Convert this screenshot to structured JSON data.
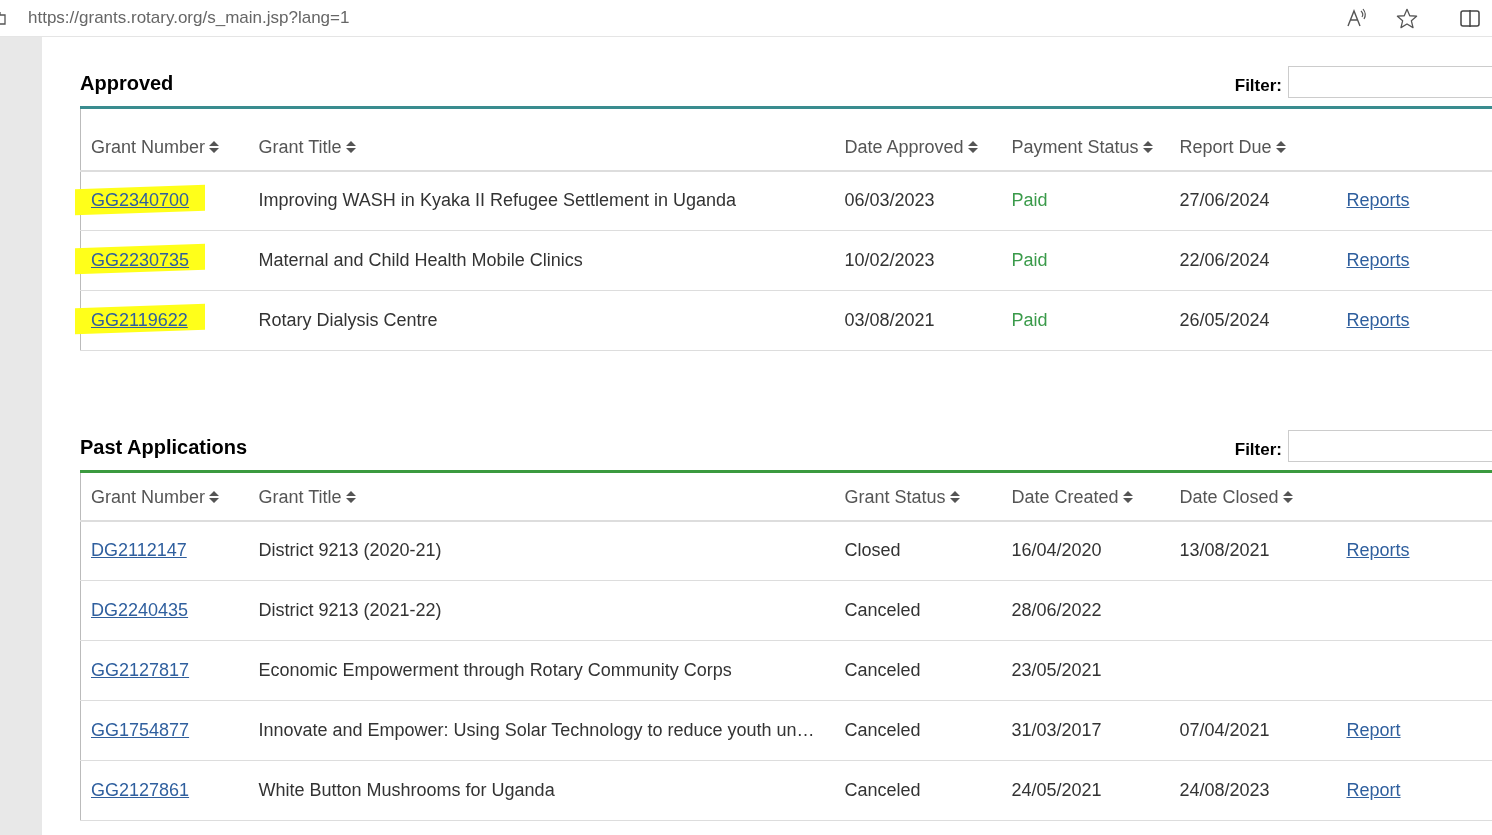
{
  "browser": {
    "url": "https://grants.rotary.org/s_main.jsp?lang=1"
  },
  "sections": [
    {
      "title": "Approved",
      "filter_label": "Filter:",
      "color": "#3a8c8f",
      "columns": [
        {
          "label": "Grant Number",
          "sortable": true
        },
        {
          "label": "Grant Title",
          "sortable": true
        },
        {
          "label": "Date Approved",
          "sortable": true
        },
        {
          "label": "Payment Status",
          "sortable": true
        },
        {
          "label": "Report Due",
          "sortable": true
        }
      ],
      "rows": [
        {
          "grant_number": "GG2340700",
          "highlighted": true,
          "title": "Improving WASH in Kyaka II Refugee Settlement in Uganda",
          "col3": "06/03/2023",
          "col4": "Paid",
          "paid": true,
          "col5": "27/06/2024",
          "link": "Reports"
        },
        {
          "grant_number": "GG2230735",
          "highlighted": true,
          "title": "Maternal and Child Health Mobile Clinics",
          "col3": "10/02/2023",
          "col4": "Paid",
          "paid": true,
          "col5": "22/06/2024",
          "link": "Reports"
        },
        {
          "grant_number": "GG2119622",
          "highlighted": true,
          "title": "Rotary Dialysis Centre",
          "col3": "03/08/2021",
          "col4": "Paid",
          "paid": true,
          "col5": "26/05/2024",
          "link": "Reports"
        }
      ]
    },
    {
      "title": "Past Applications",
      "filter_label": "Filter:",
      "color": "#3b9a3f",
      "columns": [
        {
          "label": "Grant Number",
          "sortable": true
        },
        {
          "label": "Grant Title",
          "sortable": true
        },
        {
          "label": "Grant Status",
          "sortable": true
        },
        {
          "label": "Date Created",
          "sortable": true
        },
        {
          "label": "Date Closed",
          "sortable": true
        }
      ],
      "rows": [
        {
          "grant_number": "DG2112147",
          "highlighted": false,
          "title": "District 9213 (2020-21)",
          "col3": "Closed",
          "col4": "16/04/2020",
          "col5": "13/08/2021",
          "link": "Reports"
        },
        {
          "grant_number": "DG2240435",
          "highlighted": false,
          "title": "District 9213 (2021-22)",
          "col3": "Canceled",
          "col4": "28/06/2022"
        },
        {
          "grant_number": "GG2127817",
          "highlighted": false,
          "title": "Economic Empowerment through Rotary Community Corps",
          "col3": "Canceled",
          "col4": "23/05/2021"
        },
        {
          "grant_number": "GG1754877",
          "highlighted": false,
          "title": "Innovate and Empower: Using Solar Technology to reduce youth un…",
          "col3": "Canceled",
          "col4": "31/03/2017",
          "col5": "07/04/2021",
          "link": "Report"
        },
        {
          "grant_number": "GG2127861",
          "highlighted": false,
          "title": "White Button Mushrooms for Uganda",
          "col3": "Canceled",
          "col4": "24/05/2021",
          "col5": "24/08/2023",
          "link": "Report"
        }
      ]
    }
  ]
}
